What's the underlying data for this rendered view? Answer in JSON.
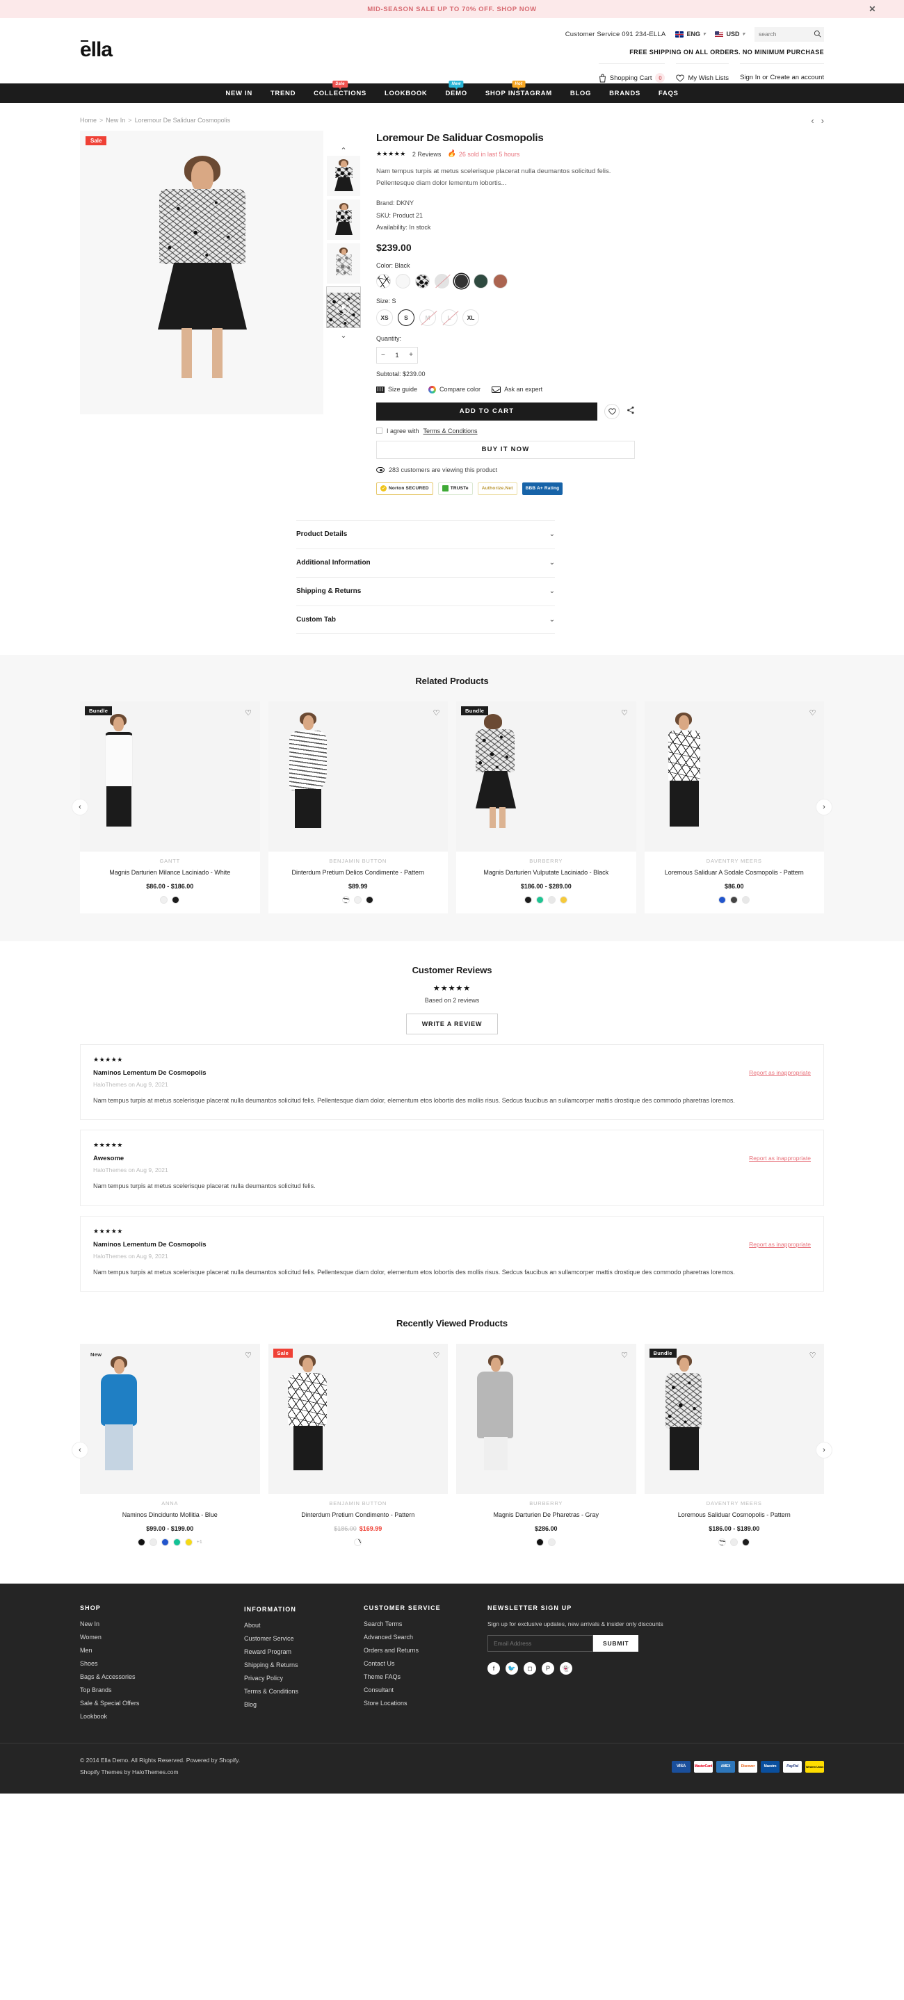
{
  "announcement": {
    "text": "MID-SEASON SALE UP TO 70% OFF. SHOP NOW",
    "close_icon": "close-icon"
  },
  "header": {
    "customer_service": "Customer Service 091 234-ELLA",
    "language": "ENG",
    "currency": "USD",
    "search_placeholder": "search",
    "logo": "ella",
    "free_shipping": "FREE SHIPPING ON ALL ORDERS. NO MINIMUM PURCHASE",
    "cart_label": "Shopping Cart",
    "cart_count": "0",
    "wishlist_label": "My Wish Lists",
    "account_label": "Sign In or Create an account"
  },
  "nav": [
    {
      "label": "NEW IN",
      "badge": null
    },
    {
      "label": "TREND",
      "badge": null
    },
    {
      "label": "COLLECTIONS",
      "badge": "Sale",
      "badge_type": "sale"
    },
    {
      "label": "LOOKBOOK",
      "badge": null
    },
    {
      "label": "DEMO",
      "badge": "New",
      "badge_type": "new"
    },
    {
      "label": "SHOP INSTAGRAM",
      "badge": "Hot",
      "badge_type": "hot"
    },
    {
      "label": "BLOG",
      "badge": null
    },
    {
      "label": "BRANDS",
      "badge": null
    },
    {
      "label": "FAQS",
      "badge": null
    }
  ],
  "breadcrumb": [
    "Home",
    "New In",
    "Loremour De Saliduar Cosmopolis"
  ],
  "product": {
    "sale_tag": "Sale",
    "title": "Loremour De Saliduar Cosmopolis",
    "stars": "★★★★★",
    "reviews_count": "2 Reviews",
    "sold_hot": "26 sold in last 5 hours",
    "description": "Nam tempus turpis at metus scelerisque placerat nulla deumantos solicitud felis. Pellentesque diam dolor lementum lobortis...",
    "brand": "Brand: DKNY",
    "sku": "SKU: Product 21",
    "availability": "Availability: In stock",
    "price": "$239.00",
    "color_label": "Color: Black",
    "colors": [
      {
        "name": "pattern-web",
        "hex": "#f2f2f2",
        "selected": false,
        "disabled": false
      },
      {
        "name": "white",
        "hex": "#f7f7f7",
        "selected": false,
        "disabled": false
      },
      {
        "name": "black-pattern",
        "hex": "#2a2a2a",
        "selected": false,
        "disabled": false
      },
      {
        "name": "light-gray",
        "hex": "#e3e3e3",
        "selected": false,
        "disabled": true
      },
      {
        "name": "black",
        "hex": "#333333",
        "selected": true,
        "disabled": false
      },
      {
        "name": "dark-green",
        "hex": "#2f4a40",
        "selected": false,
        "disabled": false
      },
      {
        "name": "brick",
        "hex": "#ab6450",
        "selected": false,
        "disabled": false
      }
    ],
    "size_label": "Size: S",
    "sizes": [
      {
        "label": "XS",
        "selected": false,
        "disabled": false
      },
      {
        "label": "S",
        "selected": true,
        "disabled": false
      },
      {
        "label": "M",
        "selected": false,
        "disabled": true
      },
      {
        "label": "L",
        "selected": false,
        "disabled": true
      },
      {
        "label": "XL",
        "selected": false,
        "disabled": false
      }
    ],
    "quantity_label": "Quantity:",
    "quantity_value": "1",
    "subtotal": "Subtotal: $239.00",
    "helpers": [
      {
        "label": "Size guide",
        "icon": "ruler-icon"
      },
      {
        "label": "Compare color",
        "icon": "color-wheel-icon"
      },
      {
        "label": "Ask an expert",
        "icon": "mail-icon"
      }
    ],
    "add_to_cart": "ADD TO CART",
    "terms_text": "I agree with",
    "terms_link": "Terms & Conditions",
    "buy_now": "BUY IT NOW",
    "viewers": "283 customers are viewing this product",
    "trust_badges": [
      "Norton SECURED",
      "TRUSTe",
      "Authorize.Net",
      "BBB A+ Rating"
    ]
  },
  "accordion": [
    {
      "title": "Product Details"
    },
    {
      "title": "Additional Information"
    },
    {
      "title": "Shipping & Returns"
    },
    {
      "title": "Custom Tab"
    }
  ],
  "related": {
    "title": "Related Products",
    "items": [
      {
        "tag": "Bundle",
        "tag_type": "bundle",
        "vendor": "GANTT",
        "name": "Magnis Darturien Milance Laciniado - White",
        "price": "$86.00 - $186.00",
        "swatches": [
          "#f0f0f0",
          "#1c1c1c"
        ],
        "image": "white-tank"
      },
      {
        "tag": null,
        "tag_type": null,
        "vendor": "BENJAMIN BUTTON",
        "name": "Dinterdum Pretium Delios Condimente - Pattern",
        "price": "$89.99",
        "swatches": [
          "#dddddd",
          "#f0f0f0",
          "#1c1c1c"
        ],
        "image": "stripe-top"
      },
      {
        "tag": "Bundle",
        "tag_type": "bundle",
        "vendor": "BURBERRY",
        "name": "Magnis Darturien Vulputate Laciniado - Black",
        "price": "$186.00 - $289.00",
        "swatches": [
          "#1c1c1c",
          "#1ec492",
          "#e8e8e8",
          "#f5c93b"
        ],
        "image": "bw-dress-back"
      },
      {
        "tag": null,
        "tag_type": null,
        "vendor": "DAVENTRY MEERS",
        "name": "Loremous Saliduar A Sodale Cosmopolis - Pattern",
        "price": "$86.00",
        "swatches": [
          "#2255cc",
          "#444444",
          "#e8e8e8"
        ],
        "image": "web-blouse"
      }
    ]
  },
  "reviews": {
    "title": "Customer Reviews",
    "stars": "★★★★★",
    "based_on": "Based on 2 reviews",
    "write_button": "WRITE A REVIEW",
    "report_label": "Report as inappropriate",
    "items": [
      {
        "stars": "★★★★★",
        "title": "Naminos Lementum De Cosmopolis",
        "author": "HaloThemes on Aug 9, 2021",
        "body": "Nam tempus turpis at metus scelerisque placerat nulla deumantos solicitud felis. Pellentesque diam dolor, elementum etos lobortis des mollis risus. Sedcus faucibus an sullamcorper mattis drostique des commodo pharetras loremos."
      },
      {
        "stars": "★★★★★",
        "title": "Awesome",
        "author": "HaloThemes on Aug 9, 2021",
        "body": "Nam tempus turpis at metus scelerisque placerat nulla deumantos solicitud felis."
      },
      {
        "stars": "★★★★★",
        "title": "Naminos Lementum De Cosmopolis",
        "author": "HaloThemes on Aug 9, 2021",
        "body": "Nam tempus turpis at metus scelerisque placerat nulla deumantos solicitud felis. Pellentesque diam dolor, elementum etos lobortis des mollis risus. Sedcus faucibus an sullamcorper mattis drostique des commodo pharetras loremos."
      }
    ]
  },
  "recent": {
    "title": "Recently Viewed Products",
    "items": [
      {
        "tag": "New",
        "tag_type": "new",
        "vendor": "ANNA",
        "name": "Naminos Dincidunto Mollitia - Blue",
        "price": "$99.00 - $199.00",
        "price_old": null,
        "price_new": null,
        "swatches": [
          "#111111",
          "#ededed",
          "#2255cc",
          "#13c296",
          "#f5d916"
        ],
        "more_swatches": "+1",
        "image": "blue-hoodie"
      },
      {
        "tag": "Sale",
        "tag_type": "sale",
        "vendor": "BENJAMIN BUTTON",
        "name": "Dinterdum Pretium Condimento - Pattern",
        "price": null,
        "price_old": "$186.00",
        "price_new": "$169.99",
        "swatches": [
          "#e9e9e9"
        ],
        "more_swatches": null,
        "image": "web-top"
      },
      {
        "tag": null,
        "tag_type": null,
        "vendor": "BURBERRY",
        "name": "Magnis Darturien De Pharetras - Gray",
        "price": "$286.00",
        "price_old": null,
        "price_new": null,
        "swatches": [
          "#111111",
          "#ededed"
        ],
        "more_swatches": null,
        "image": "gray-cardigan"
      },
      {
        "tag": "Bundle",
        "tag_type": "bundle",
        "vendor": "DAVENTRY MEERS",
        "name": "Loremous Saliduar Cosmopolis - Pattern",
        "price": "$186.00 - $189.00",
        "price_old": null,
        "price_new": null,
        "swatches": [
          "#dedede",
          "#ededed",
          "#1c1c1c"
        ],
        "more_swatches": null,
        "image": "bw-dress"
      }
    ]
  },
  "footer": {
    "columns": [
      {
        "heading": "SHOP",
        "links": [
          "New In",
          "Women",
          "Men",
          "Shoes",
          "Bags & Accessories",
          "Top Brands",
          "Sale & Special Offers",
          "Lookbook"
        ]
      },
      {
        "heading": "INFORMATION",
        "links": [
          "About",
          "Customer Service",
          "Reward Program",
          "Shipping & Returns",
          "Privacy Policy",
          "Terms & Conditions",
          "Blog"
        ]
      },
      {
        "heading": "CUSTOMER SERVICE",
        "links": [
          "Search Terms",
          "Advanced Search",
          "Orders and Returns",
          "Contact Us",
          "Theme FAQs",
          "Consultant",
          "Store Locations"
        ]
      }
    ],
    "newsletter": {
      "heading": "NEWSLETTER SIGN UP",
      "desc": "Sign up for exclusive updates, new arrivals & insider only discounts",
      "placeholder": "Email Address",
      "submit": "SUBMIT"
    },
    "socials": [
      "facebook-icon",
      "twitter-icon",
      "instagram-icon",
      "pinterest-icon",
      "snapchat-icon"
    ],
    "copyright_line1": "© 2014 Ella Demo. All Rights Reserved. Powered by Shopify.",
    "copyright_line2": "Shopify Themes by HaloThemes.com",
    "payments": [
      "VISA",
      "MasterCard",
      "AMEX",
      "Discover",
      "Maestro",
      "PayPal",
      "Western Union"
    ]
  }
}
